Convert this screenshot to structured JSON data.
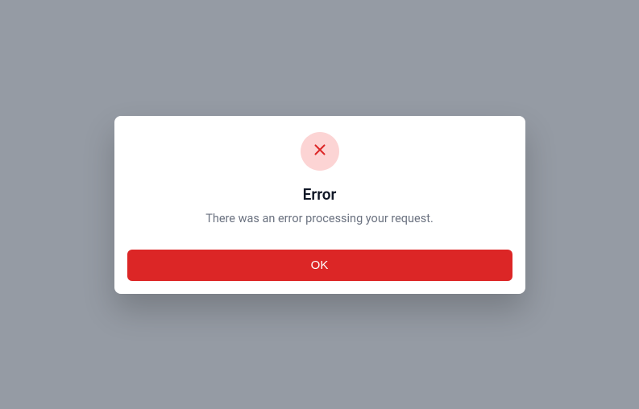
{
  "dialog": {
    "title": "Error",
    "message": "There was an error processing your request.",
    "ok_label": "OK",
    "icon_color": "#dc2626",
    "icon_bg": "#fcd4d4"
  }
}
